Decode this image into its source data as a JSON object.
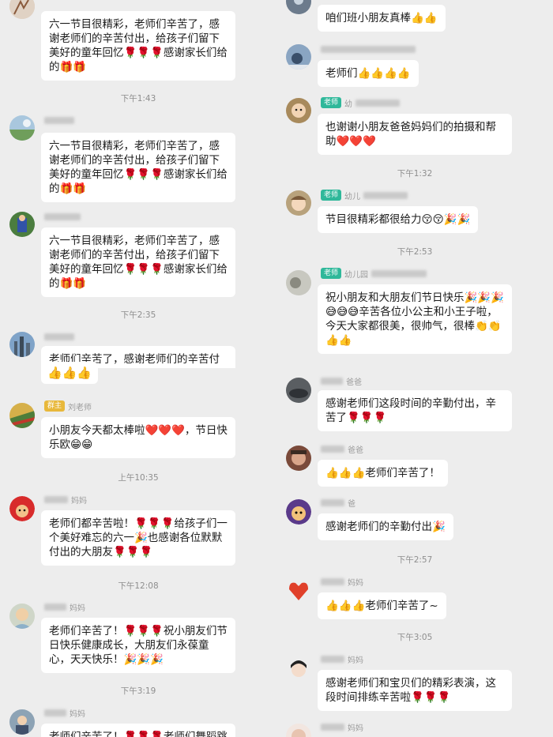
{
  "left": {
    "times": [
      "下午1:43",
      "下午2:35",
      "上午10:35",
      "下午12:08",
      "下午3:19"
    ],
    "messages": [
      {
        "text": "六一节目很精彩，老师们辛苦了，感谢老师们的辛苦付出，给孩子们留下美好的童年回忆🌹🌹🌹感谢家长们给的🎁🎁"
      },
      {
        "text": "六一节目很精彩，老师们辛苦了，感谢老师们的辛苦付出，给孩子们留下美好的童年回忆🌹🌹🌹感谢家长们给的🎁🎁"
      },
      {
        "text": "六一节目很精彩，老师们辛苦了，感谢老师们的辛苦付出，给孩子们留下美好的童年回忆🌹🌹🌹感谢家长们给的🎁🎁"
      },
      {
        "text": "老师们辛苦了，感谢老师们的辛苦付"
      },
      {
        "text": "👍👍👍"
      },
      {
        "badge": "群主",
        "name": "刘老师",
        "text": "小朋友今天都太棒啦❤️❤️❤️，节日快乐欧😁😁"
      },
      {
        "name": "妈妈",
        "text": "老师们都辛苦啦！🌹🌹🌹给孩子们一个美好难忘的六一🎉也感谢各位默默付出的大朋友🌹🌹🌹"
      },
      {
        "name": "妈妈",
        "text": "老师们辛苦了！🌹🌹🌹祝小朋友们节日快乐健康成长，大朋友们永葆童心，天天快乐！🎉🎉🎉"
      },
      {
        "name": "妈妈",
        "text": "老师们辛苦了！🌹🌹🌹老师们舞蹈跳"
      }
    ]
  },
  "right": {
    "times": [
      "下午1:32",
      "下午2:53",
      "下午2:57",
      "下午3:05"
    ],
    "messages": [
      {
        "text": "咱们班小朋友真棒👍👍"
      },
      {
        "text": "老师们👍👍👍👍"
      },
      {
        "badge": "老师",
        "name": "幼",
        "text": "也谢谢小朋友爸爸妈妈们的拍摄和帮助❤️❤️❤️"
      },
      {
        "badge": "老师",
        "name": "幼儿",
        "text": "节目很精彩都很给力😚😚🎉🎉"
      },
      {
        "badge": "老师",
        "name": "幼儿园",
        "text": "祝小朋友和大朋友们节日快乐🎉🎉🎉😅😅😅辛苦各位小公主和小王子啦，今天大家都很美，很帅气，很棒👏👏👍👍"
      },
      {
        "name": "爸爸",
        "text": "感谢老师们这段时间的辛勤付出，辛苦了🌹🌹🌹"
      },
      {
        "name": "爸爸",
        "text": "👍👍👍老师们辛苦了！"
      },
      {
        "name": "爸",
        "text": "感谢老师们的辛勤付出🎉"
      },
      {
        "name": "妈妈",
        "text": "👍👍👍老师们辛苦了~"
      },
      {
        "name": "妈妈",
        "text": "感谢老师们和宝贝们的精彩表演，这段时间排练辛苦啦🌹🌹🌹"
      },
      {
        "name": "妈妈",
        "text": ""
      }
    ]
  },
  "colors": {
    "background": "#ededed",
    "bubble": "#ffffff",
    "teacher_badge": "#2fb89a",
    "owner_badge": "#e8b83b"
  }
}
